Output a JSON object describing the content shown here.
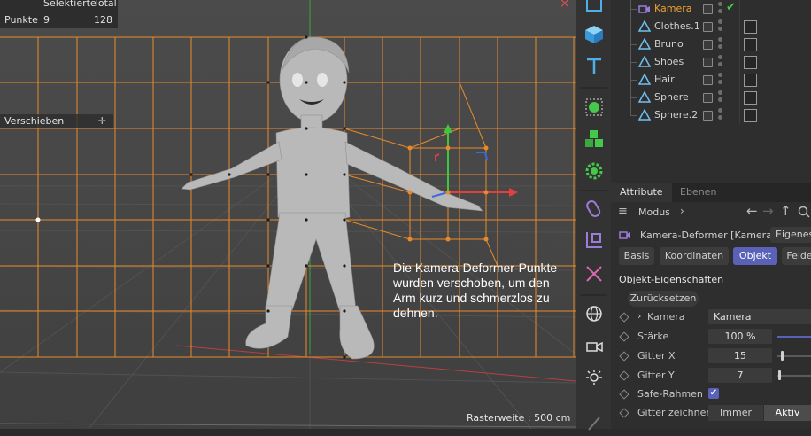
{
  "viewport": {
    "stats": {
      "header_selected": "Selektierte",
      "header_total": "Total",
      "row_label": "Punkte",
      "selected": "9",
      "total": "128"
    },
    "tool_label": "Verschieben",
    "annotation": "Die Kamera-Deformer-Punkte wurden verschoben, um den Arm kurz und schmerzlos zu dehnen.",
    "grid_size": "Rasterweite : 500 cm",
    "accent_color": "#e88a2a"
  },
  "toolbar": {
    "icons": [
      "layer-icon",
      "cube-icon",
      "text-icon",
      "spline-select-icon",
      "generator-cubes-icon",
      "deformer-gear-icon",
      "paint-brush-icon",
      "scale-icon",
      "bend-deformer-icon",
      "globe-scene-icon",
      "camera-scene-icon",
      "light-scene-icon"
    ]
  },
  "object_manager": {
    "objects": [
      {
        "name": "Kamera",
        "selected": true
      },
      {
        "name": "Clothes.1",
        "selected": false
      },
      {
        "name": "Bruno",
        "selected": false
      },
      {
        "name": "Shoes",
        "selected": false
      },
      {
        "name": "Hair",
        "selected": false
      },
      {
        "name": "Sphere",
        "selected": false
      },
      {
        "name": "Sphere.2",
        "selected": false
      }
    ]
  },
  "attribute_manager": {
    "tabs": [
      "Attribute",
      "Ebenen"
    ],
    "mode_label": "Modus",
    "object_title": "Kamera-Deformer [Kamera]",
    "own_button": "Eigenes",
    "subtabs": [
      "Basis",
      "Koordinaten",
      "Objekt",
      "Felde"
    ],
    "active_subtab": "Objekt",
    "section_title": "Objekt-Eigenschaften",
    "reset_label": "Zurücksetzen",
    "properties": {
      "kamera": {
        "label": "Kamera",
        "value": "Kamera"
      },
      "staerke": {
        "label": "Stärke",
        "value": "100 %",
        "level": 1.0
      },
      "gitter_x": {
        "label": "Gitter X",
        "value": "15"
      },
      "gitter_y": {
        "label": "Gitter Y",
        "value": "7"
      },
      "safe_rahmen": {
        "label": "Safe-Rahmen",
        "checked": true
      },
      "gitter_zeichnen": {
        "label": "Gitter zeichnen",
        "options": [
          "Immer",
          "Aktiv"
        ],
        "selected": "Aktiv"
      }
    }
  }
}
